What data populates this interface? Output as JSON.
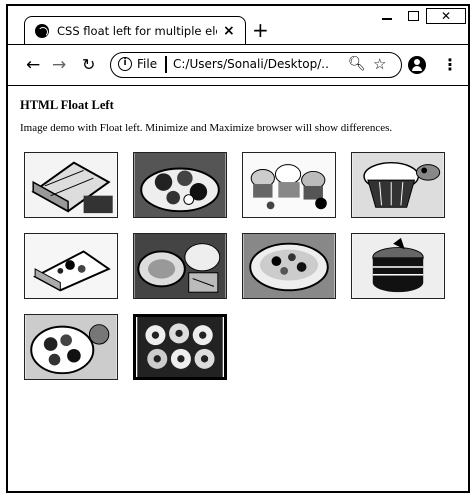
{
  "browser": {
    "tab_title": "CSS float left for multiple elemen",
    "tab_close": "×",
    "new_tab": "+",
    "close_window": "✕",
    "scheme_label": "File",
    "url": "C:/Users/Sonali/Desktop/..."
  },
  "page": {
    "heading": "HTML Float Left",
    "description": "Image demo with Float left. Minimize and Maximize browser will show differences."
  },
  "gallery": {
    "images": [
      {
        "subject": "cake-slice"
      },
      {
        "subject": "dessert-plate"
      },
      {
        "subject": "cupcakes"
      },
      {
        "subject": "cupcake-closeup"
      },
      {
        "subject": "cheesecake-slice"
      },
      {
        "subject": "pie-table"
      },
      {
        "subject": "fruit-tart"
      },
      {
        "subject": "chocolate-cake"
      },
      {
        "subject": "berry-tart"
      },
      {
        "subject": "donuts-tray",
        "selected": true
      }
    ]
  }
}
